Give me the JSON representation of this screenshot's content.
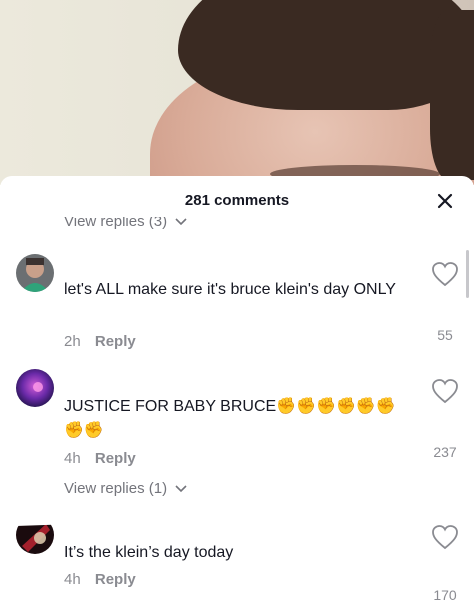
{
  "header": {
    "comment_count": "281 comments"
  },
  "icons": {
    "close": "close-icon",
    "heart": "heart-icon",
    "chevron": "chevron-down-icon",
    "fist": "raised-fist-emoji"
  },
  "comments": [
    {
      "username": "",
      "text": "let's ALL make sure it's bruce klein's day ONLY",
      "time": "2h",
      "reply_label": "Reply",
      "likes": "55"
    },
    {
      "username": "",
      "text": "JUSTICE FOR BABY BRUCE✊✊✊✊✊✊✊✊",
      "time": "4h",
      "reply_label": "Reply",
      "likes": "237",
      "view_replies": "View replies (1)"
    },
    {
      "username": "",
      "text": "It’s the klein’s day today",
      "time": "4h",
      "reply_label": "Reply",
      "likes": "170"
    }
  ],
  "top_view_replies": "View replies (3)",
  "colors": {
    "text_primary": "#161823",
    "text_secondary": "#8a8b91",
    "sheet_bg": "#ffffff"
  }
}
